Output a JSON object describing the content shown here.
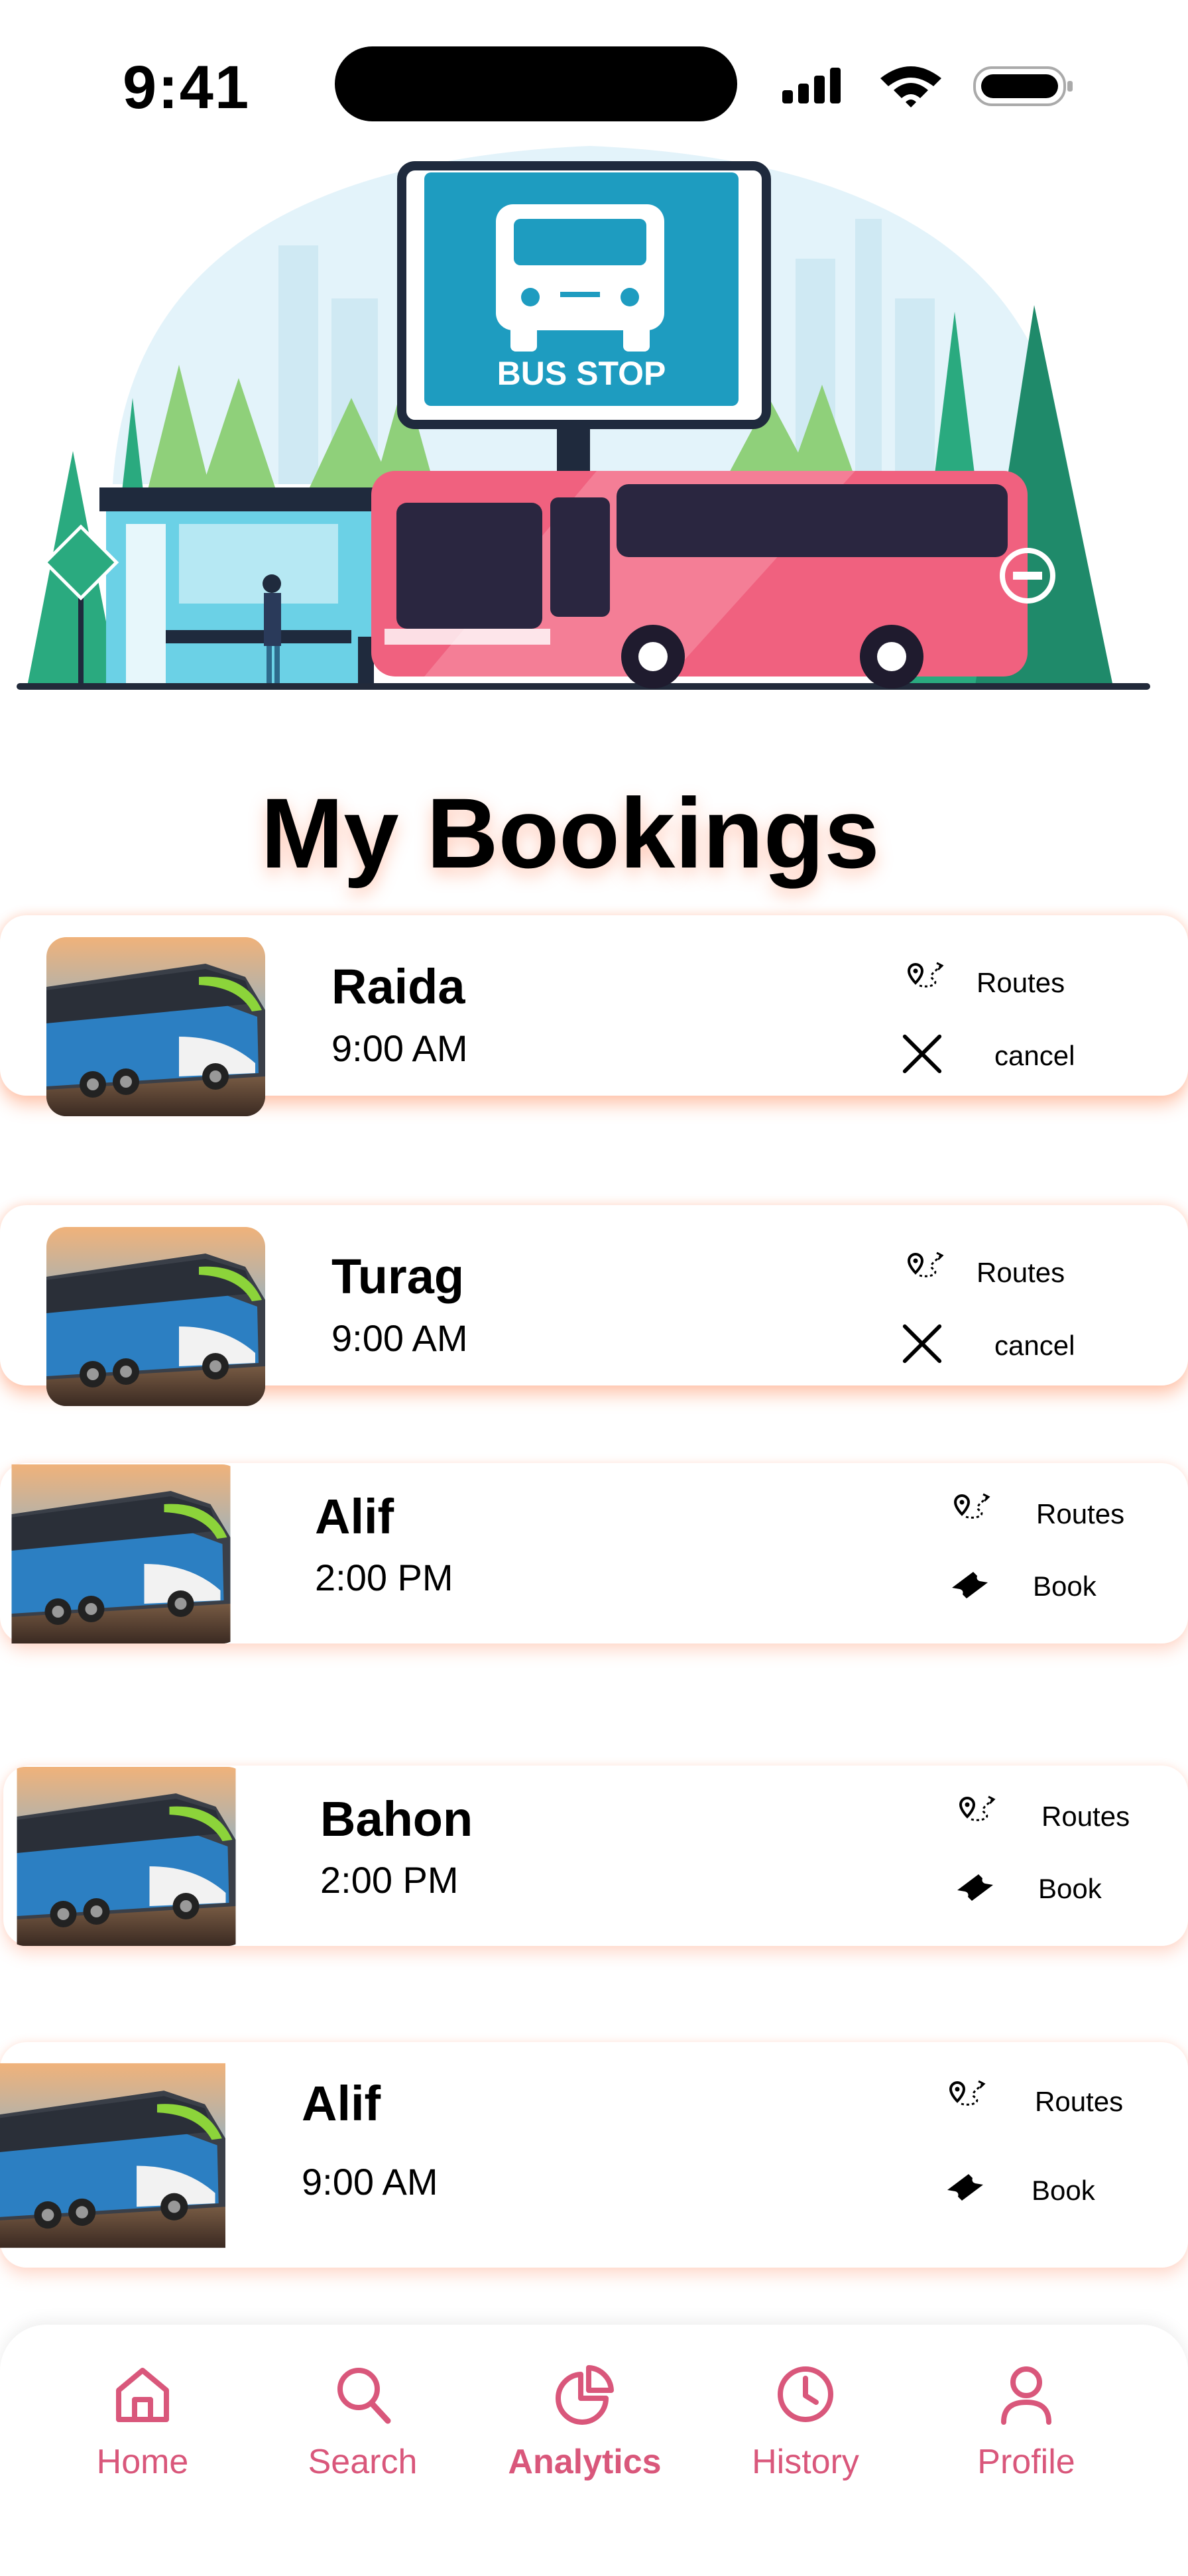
{
  "status_bar": {
    "time": "9:41"
  },
  "hero": {
    "sign_text": "BUS STOP"
  },
  "page": {
    "title": "My Bookings"
  },
  "bookings": [
    {
      "name": "Raida",
      "time": "9:00 AM",
      "primary_action": "Routes",
      "secondary_action": "cancel",
      "secondary_icon": "close-icon"
    },
    {
      "name": "Turag",
      "time": "9:00 AM",
      "primary_action": "Routes",
      "secondary_action": "cancel",
      "secondary_icon": "close-icon"
    },
    {
      "name": "Alif",
      "time": "2:00 PM",
      "primary_action": "Routes",
      "secondary_action": "Book",
      "secondary_icon": "ticket-icon"
    },
    {
      "name": "Bahon",
      "time": "2:00 PM",
      "primary_action": "Routes",
      "secondary_action": "Book",
      "secondary_icon": "ticket-icon"
    },
    {
      "name": "Alif",
      "time": "9:00 AM",
      "primary_action": "Routes",
      "secondary_action": "Book",
      "secondary_icon": "ticket-icon"
    }
  ],
  "nav": {
    "items": [
      {
        "label": "Home",
        "icon": "home-icon"
      },
      {
        "label": "Search",
        "icon": "search-icon"
      },
      {
        "label": "Analytics",
        "icon": "analytics-icon",
        "active": true
      },
      {
        "label": "History",
        "icon": "history-icon"
      },
      {
        "label": "Profile",
        "icon": "profile-icon"
      }
    ]
  },
  "colors": {
    "accent": "#d9577b",
    "card_shadow": "#ff7a3d",
    "sign_blue": "#1e9cc0",
    "bus_pink": "#f0617f"
  }
}
